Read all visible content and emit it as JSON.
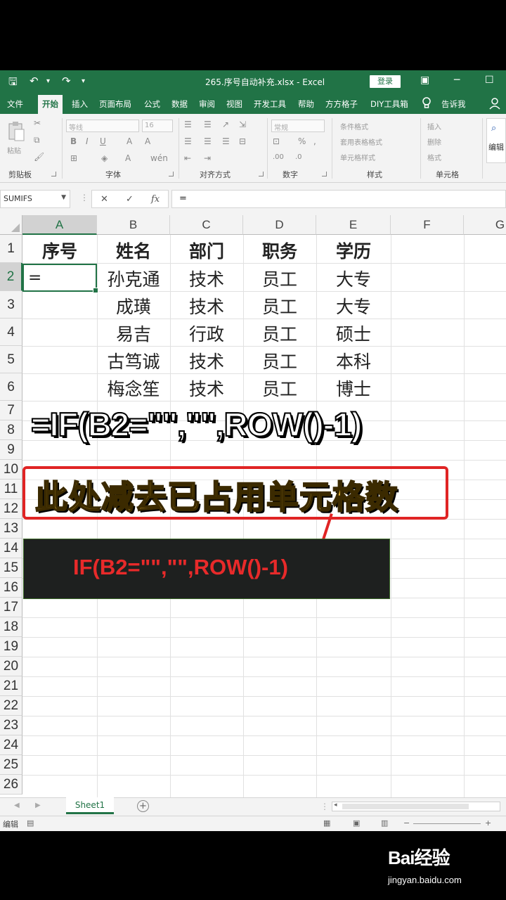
{
  "window": {
    "doc_title": "265.序号自动补充.xlsx  -  Excel",
    "login_label": "登录",
    "minimize": "─",
    "restore": "☐"
  },
  "menu": {
    "tabs": [
      "文件",
      "开始",
      "插入",
      "页面布局",
      "公式",
      "数据",
      "审阅",
      "视图",
      "开发工具",
      "帮助",
      "方方格子",
      "DIY工具箱"
    ],
    "active_tab": "开始",
    "tell_me": "告诉我"
  },
  "ribbon": {
    "groups": [
      "剪贴板",
      "字体",
      "对齐方式",
      "数字",
      "样式",
      "单元格"
    ],
    "paste": "粘贴",
    "font_name": "等线",
    "font_size": "16",
    "number_format": "常规",
    "styles": [
      "条件格式",
      "套用表格格式",
      "单元格样式"
    ],
    "cells": [
      "插入",
      "删除",
      "格式"
    ],
    "edit": "编辑"
  },
  "formula_bar": {
    "name_box": "SUMIFS",
    "content": "="
  },
  "columns": [
    "A",
    "B",
    "C",
    "D",
    "E",
    "F",
    "G"
  ],
  "active_column": "A",
  "rows": [
    "1",
    "2",
    "3",
    "4",
    "5",
    "6",
    "7",
    "8",
    "9",
    "10",
    "11",
    "12",
    "13",
    "14",
    "15",
    "16",
    "17",
    "18",
    "19",
    "20",
    "21",
    "22",
    "23",
    "24",
    "25",
    "26"
  ],
  "active_row": "2",
  "table": {
    "headers": [
      "序号",
      "姓名",
      "部门",
      "职务",
      "学历"
    ],
    "rows": [
      [
        "=",
        "孙克通",
        "技术",
        "员工",
        "大专"
      ],
      [
        "",
        "成璜",
        "技术",
        "员工",
        "大专"
      ],
      [
        "",
        "易吉",
        "行政",
        "员工",
        "硕士"
      ],
      [
        "",
        "古笃诚",
        "技术",
        "员工",
        "本科"
      ],
      [
        "",
        "梅念笙",
        "技术",
        "员工",
        "博士"
      ]
    ]
  },
  "overlay": {
    "big_formula": "=IF(B2=\"\",\"\",ROW()-1)",
    "callout_text": "此处减去已占用单元格数",
    "red_formula": "IF(B2=\"\",\"\",ROW()-1)"
  },
  "sheet_tab": "Sheet1",
  "add_sheet": "+",
  "status": {
    "mode": "编辑"
  },
  "watermark": {
    "brand": "Bai经验",
    "url": "jingyan.baidu.com"
  },
  "colors": {
    "excel_green": "#217346",
    "callout_red": "#e02424",
    "callout_text": "#f5c242",
    "formula_red": "#e82a2a"
  }
}
